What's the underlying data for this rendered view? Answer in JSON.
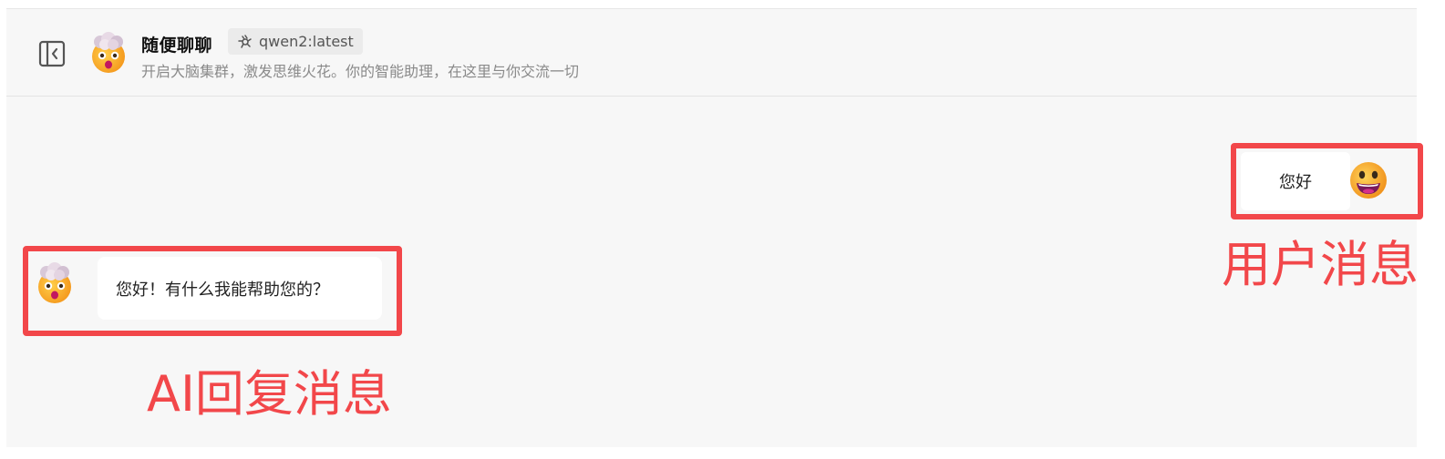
{
  "header": {
    "title": "随便聊聊",
    "model_tag": "qwen2:latest",
    "subtitle": "开启大脑集群，激发思维火花。你的智能助理，在这里与你交流一切",
    "toggle_icon": "sidebar-toggle-icon",
    "avatar_icon": "mind-blown-emoji-icon",
    "model_icon": "ollama-model-icon"
  },
  "messages": [
    {
      "role": "user",
      "text": "您好",
      "avatar_icon": "grinning-emoji-icon"
    },
    {
      "role": "assistant",
      "text": "您好！有什么我能帮助您的？",
      "avatar_icon": "mind-blown-emoji-icon"
    }
  ],
  "annotations": {
    "user_label": "用户消息",
    "ai_label": "AI回复消息",
    "color": "#f2474a"
  },
  "colors": {
    "background": "#f7f7f7",
    "bubble": "#ffffff",
    "highlight": "#f2474a"
  }
}
